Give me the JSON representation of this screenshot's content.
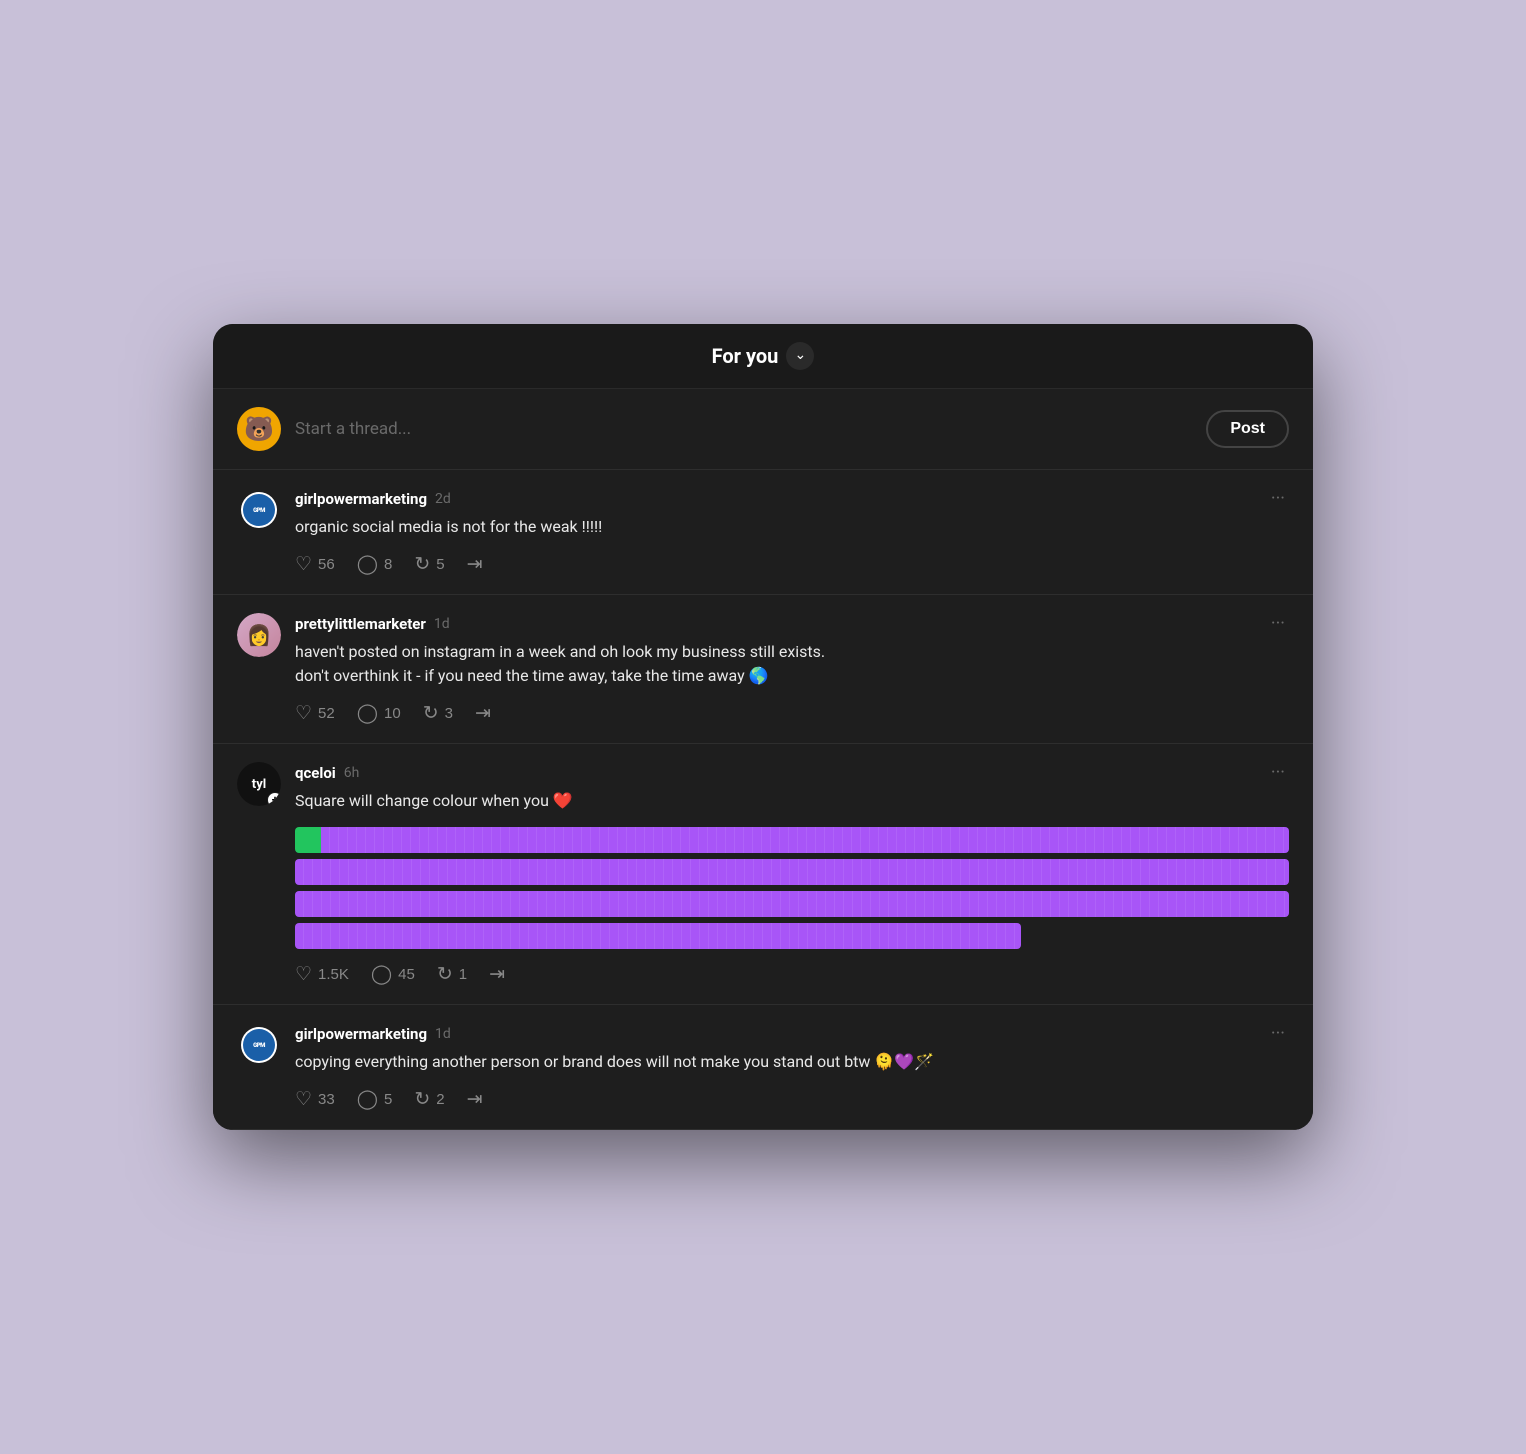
{
  "header": {
    "title": "For you",
    "chevron_label": "chevron down"
  },
  "compose": {
    "placeholder": "Start a thread...",
    "post_button": "Post",
    "avatar_emoji": "🐻"
  },
  "posts": [
    {
      "id": "post1",
      "author": "girlpowermarketing",
      "time": "2d",
      "text": "organic social media is not for the weak !!!!!",
      "likes": "56",
      "comments": "8",
      "reposts": "5",
      "avatar_type": "gpm"
    },
    {
      "id": "post2",
      "author": "prettylittlemarketer",
      "time": "1d",
      "text": "haven't posted on instagram in a week and oh look my business still exists.\ndon't overthink it - if you need the time away, take the time away 🌎",
      "likes": "52",
      "comments": "10",
      "reposts": "3",
      "avatar_type": "plm"
    },
    {
      "id": "post3",
      "author": "qceloi",
      "time": "6h",
      "text": "Square will change colour when you ❤️",
      "likes": "1.5K",
      "comments": "45",
      "reposts": "1",
      "avatar_type": "tyl",
      "has_bars": true
    },
    {
      "id": "post4",
      "author": "girlpowermarketing",
      "time": "1d",
      "text": "copying everything another person or brand does will not make you stand out btw 🫠💜🪄",
      "likes": "33",
      "comments": "5",
      "reposts": "2",
      "avatar_type": "gpm"
    }
  ],
  "labels": {
    "more_options": "···",
    "like_icon": "♡",
    "comment_icon": "💬",
    "repost_icon": "🔁",
    "share_icon": "send"
  }
}
